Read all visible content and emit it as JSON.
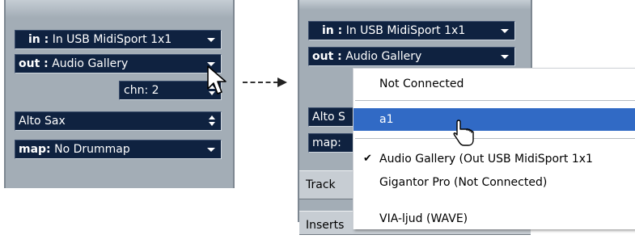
{
  "left_panel": {
    "input_label": "in :",
    "input_value": "In USB MidiSport 1x1",
    "output_label": "out :",
    "output_value": "Audio Gallery",
    "channel_label": "chn:",
    "channel_value": "2",
    "program_value": "Alto Sax",
    "map_label": "map:",
    "map_value": "No Drummap"
  },
  "right_panel": {
    "input_label": "in :",
    "input_value": "In USB MidiSport 1x1",
    "output_label": "out :",
    "output_value": "Audio Gallery",
    "program_value": "Alto S",
    "map_label": "map:",
    "tab_track": "Track",
    "tab_inserts": "Inserts"
  },
  "output_menu": {
    "items": [
      {
        "label": "Not Connected",
        "checked": false,
        "selected": false
      },
      {
        "label": "a1",
        "checked": false,
        "selected": true
      },
      {
        "label": "Audio Gallery (Out USB MidiSport 1x1",
        "checked": true,
        "selected": false
      },
      {
        "label": "Gigantor Pro (Not Connected)",
        "checked": false,
        "selected": false
      },
      {
        "label": "VIA-ljud (WAVE)",
        "checked": false,
        "selected": false
      }
    ],
    "check_glyph": "✔",
    "highlight_color": "#316ac5"
  },
  "icons": {
    "dropdown": "triangle-down",
    "spinner": "up-down-arrows",
    "pointer": "arrow-cursor",
    "hand": "hand-cursor",
    "callout": "dashed-arrow-right"
  }
}
